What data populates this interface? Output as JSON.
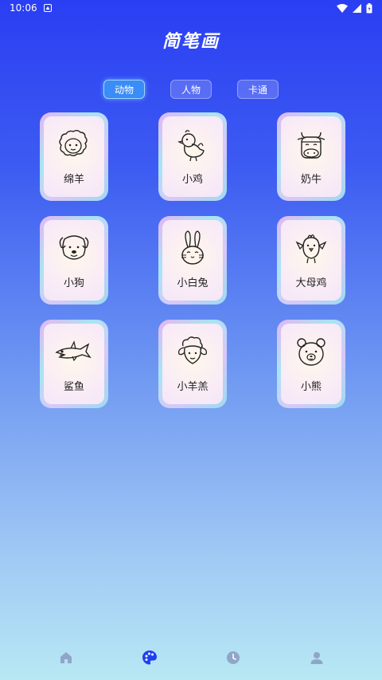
{
  "status_bar": {
    "time": "10:06"
  },
  "title": "简笔画",
  "tabs": [
    {
      "label": "动物",
      "active": true
    },
    {
      "label": "人物",
      "active": false
    },
    {
      "label": "卡通",
      "active": false
    }
  ],
  "items": [
    {
      "label": "绵羊",
      "icon": "sheep-icon"
    },
    {
      "label": "小鸡",
      "icon": "chick-icon"
    },
    {
      "label": "奶牛",
      "icon": "cow-icon"
    },
    {
      "label": "小狗",
      "icon": "dog-icon"
    },
    {
      "label": "小白兔",
      "icon": "rabbit-icon"
    },
    {
      "label": "大母鸡",
      "icon": "hen-icon"
    },
    {
      "label": "鲨鱼",
      "icon": "shark-icon"
    },
    {
      "label": "小羊羔",
      "icon": "lamb-icon"
    },
    {
      "label": "小熊",
      "icon": "bear-icon"
    }
  ],
  "nav": [
    {
      "icon": "home-icon",
      "active": false
    },
    {
      "icon": "palette-icon",
      "active": true
    },
    {
      "icon": "clock-icon",
      "active": false
    },
    {
      "icon": "profile-icon",
      "active": false
    }
  ],
  "colors": {
    "nav_active": "#1f3ff0",
    "nav_inactive": "#8fa6c8"
  }
}
